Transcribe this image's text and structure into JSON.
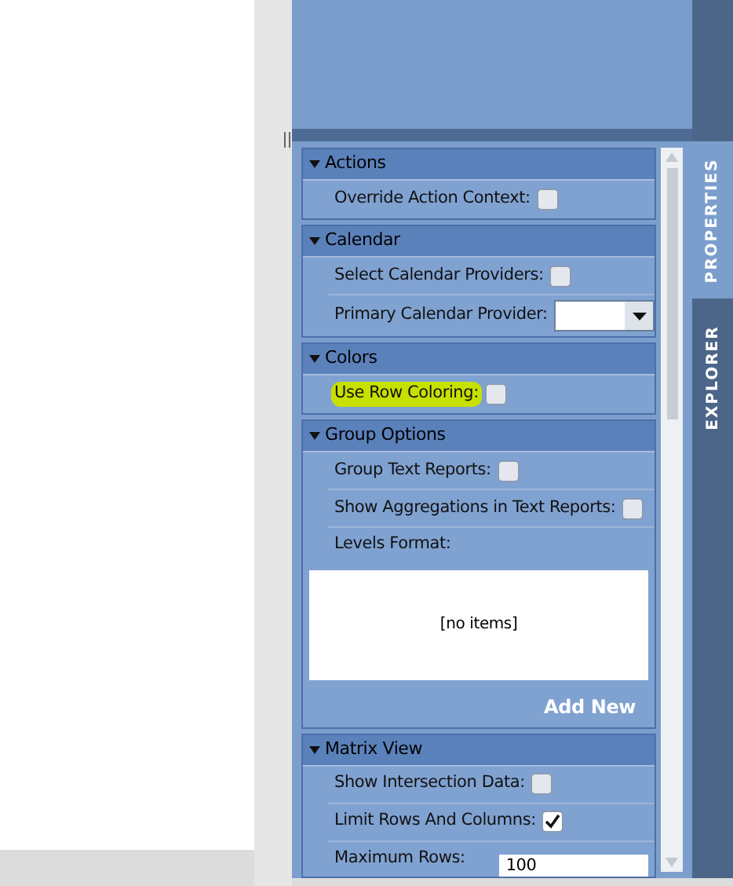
{
  "sections": [
    {
      "title": "Actions",
      "expanded": true,
      "rows": [
        {
          "kind": "checkbox",
          "label": "Override Action Context:",
          "checked": false,
          "highlighted": false
        }
      ]
    },
    {
      "title": "Calendar",
      "expanded": true,
      "rows": [
        {
          "kind": "checkbox",
          "label": "Select Calendar Providers:",
          "checked": false,
          "highlighted": false
        },
        {
          "kind": "select",
          "label": "Primary Calendar Provider:",
          "highlighted": false
        }
      ]
    },
    {
      "title": "Colors",
      "expanded": true,
      "rows": [
        {
          "kind": "checkbox",
          "label": "Use Row Coloring:",
          "checked": false,
          "highlighted": true
        }
      ]
    },
    {
      "title": "Group Options",
      "expanded": true,
      "rows": [
        {
          "kind": "checkbox",
          "label": "Group Text Reports:",
          "checked": false,
          "highlighted": false
        },
        {
          "kind": "checkbox",
          "label": "Show Aggregations in Text Reports:",
          "checked": false,
          "highlighted": false
        },
        {
          "kind": "list",
          "label": "Levels Format:",
          "empty_text": "[no items]",
          "action": "Add New",
          "highlighted": false
        }
      ]
    },
    {
      "title": "Matrix View",
      "expanded": true,
      "rows": [
        {
          "kind": "checkbox",
          "label": "Show Intersection Data:",
          "checked": false,
          "highlighted": false
        },
        {
          "kind": "checkbox",
          "label": "Limit Rows And Columns:",
          "checked": true,
          "highlighted": false
        },
        {
          "kind": "number",
          "label": "Maximum Rows:",
          "value": "100",
          "highlighted": false
        }
      ]
    }
  ],
  "side_tabs": [
    {
      "label": "PROPERTIES",
      "selected": true
    },
    {
      "label": "EXPLORER",
      "selected": false
    }
  ]
}
